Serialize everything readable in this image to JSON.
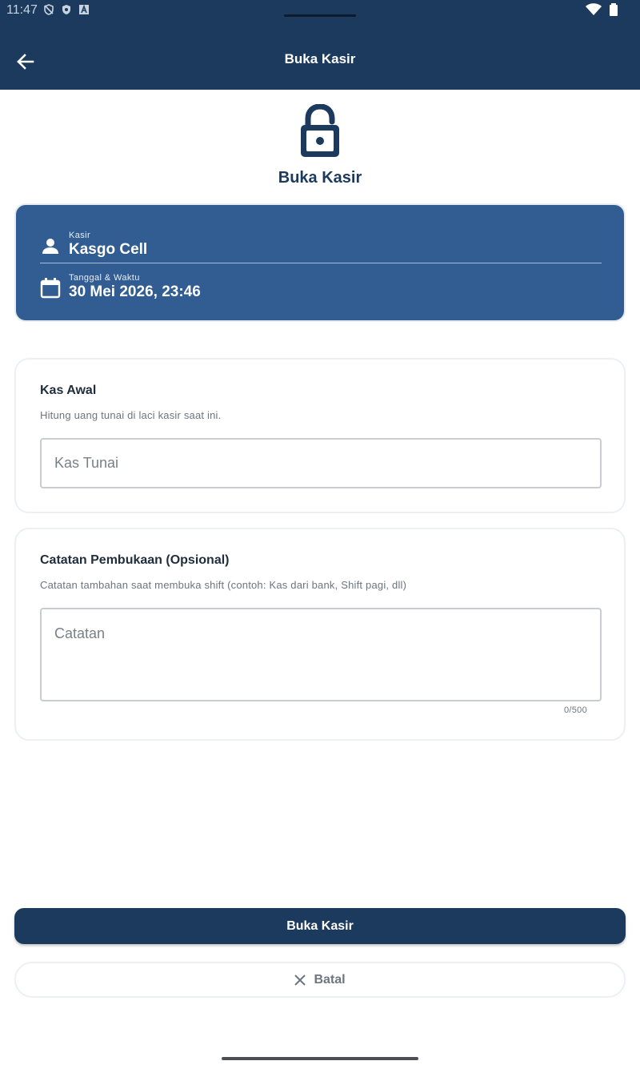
{
  "status_bar": {
    "time": "11:47",
    "icons_left": [
      "shield-off-icon",
      "vpn-icon",
      "a-icon"
    ],
    "icons_right": [
      "wifi-icon",
      "battery-icon"
    ]
  },
  "app_bar": {
    "title": "Buka Kasir",
    "back_icon": "arrow-left-icon"
  },
  "header": {
    "icon": "lock-open-icon",
    "title": "Buka Kasir"
  },
  "info_card": {
    "cashier": {
      "label": "Kasir",
      "value": "Kasgo Cell",
      "icon": "person-icon"
    },
    "datetime": {
      "label": "Tanggal & Waktu",
      "value": "30 Mei 2026, 23:46",
      "icon": "calendar-icon"
    }
  },
  "opening_cash": {
    "title": "Kas Awal",
    "subtitle": "Hitung uang tunai di laci kasir saat ini.",
    "placeholder": "Kas Tunai",
    "value": ""
  },
  "notes": {
    "title": "Catatan Pembukaan (Opsional)",
    "subtitle": "Catatan tambahan saat membuka shift (contoh: Kas dari bank, Shift pagi, dll)",
    "placeholder": "Catatan",
    "value": "",
    "counter": "0/500"
  },
  "actions": {
    "primary_label": "Buka Kasir",
    "secondary_label": "Batal",
    "secondary_icon": "close-icon"
  },
  "colors": {
    "primary": "#1b3a5e",
    "card_blue": "#325d93",
    "text_dark": "#1f2d3d",
    "text_muted": "#6c7580"
  }
}
